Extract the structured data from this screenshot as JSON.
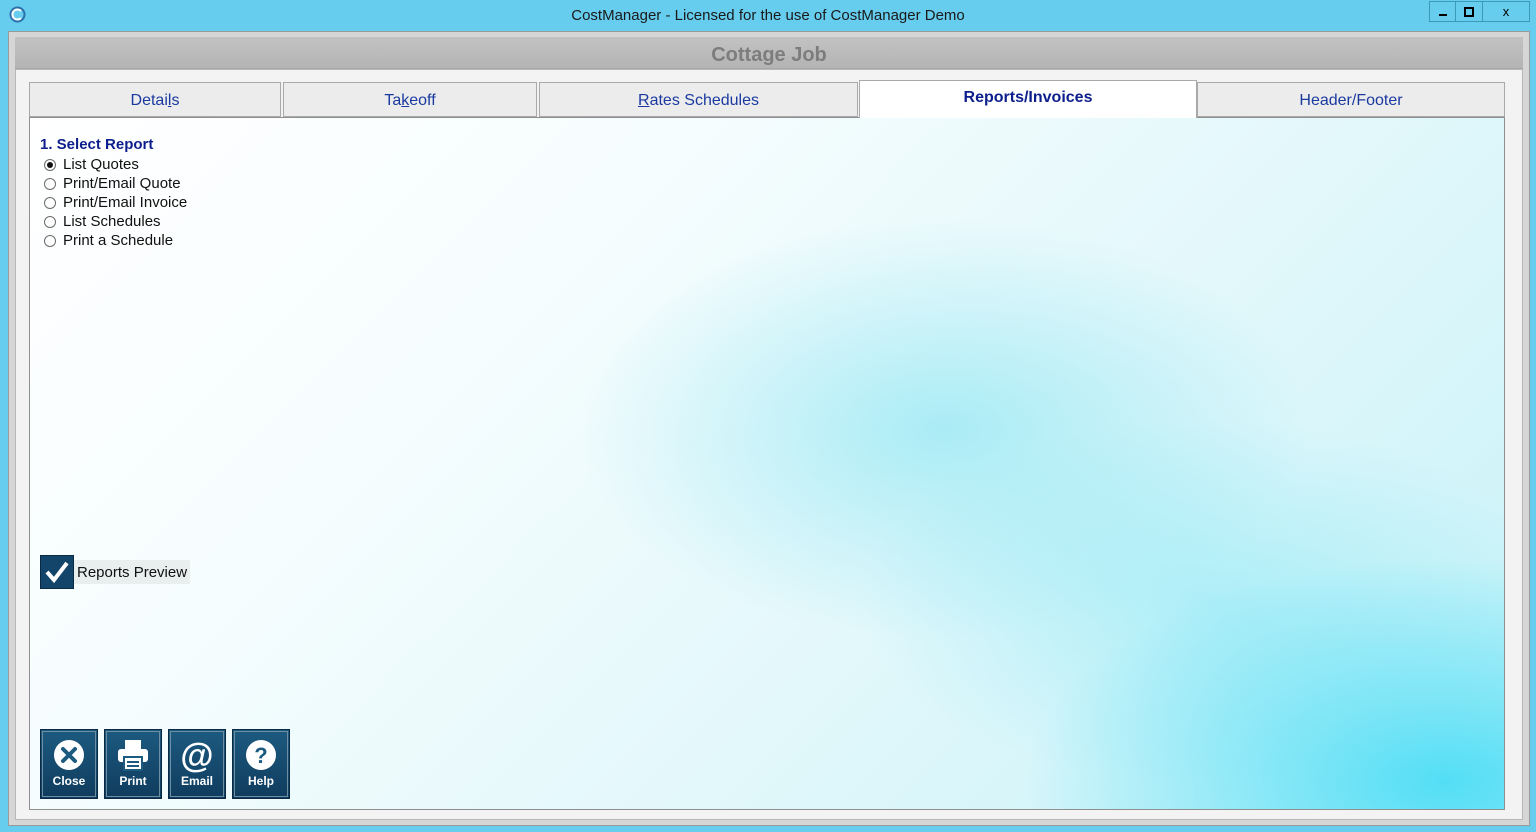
{
  "window": {
    "title": "CostManager - Licensed for the use of CostManager Demo",
    "minimize_label": "–",
    "maximize_label": "□",
    "close_label": "x"
  },
  "job": {
    "title": "Cottage Job"
  },
  "tabs": [
    {
      "pre": "Detai",
      "key": "l",
      "post": "s",
      "active": false
    },
    {
      "pre": "Ta",
      "key": "k",
      "post": "eoff",
      "active": false
    },
    {
      "pre": "",
      "key": "R",
      "post": "ates Schedules",
      "active": false
    },
    {
      "label": "Reports/Invoices",
      "active": true
    },
    {
      "label": "Header/Footer",
      "active": false
    }
  ],
  "report_section": {
    "label": "1. Select Report",
    "options": [
      {
        "label": "List Quotes",
        "selected": true
      },
      {
        "label": "Print/Email Quote",
        "selected": false
      },
      {
        "label": "Print/Email Invoice",
        "selected": false
      },
      {
        "label": "List Schedules",
        "selected": false
      },
      {
        "label": "Print a Schedule",
        "selected": false
      }
    ]
  },
  "preview": {
    "label": "Reports Preview",
    "checked": true
  },
  "actions": {
    "close": "Close",
    "print": "Print",
    "email": "Email",
    "help": "Help"
  },
  "colors": {
    "titlebar": "#66cdee",
    "accent_text": "#0d1f8c",
    "button_bg": "#13456b"
  }
}
